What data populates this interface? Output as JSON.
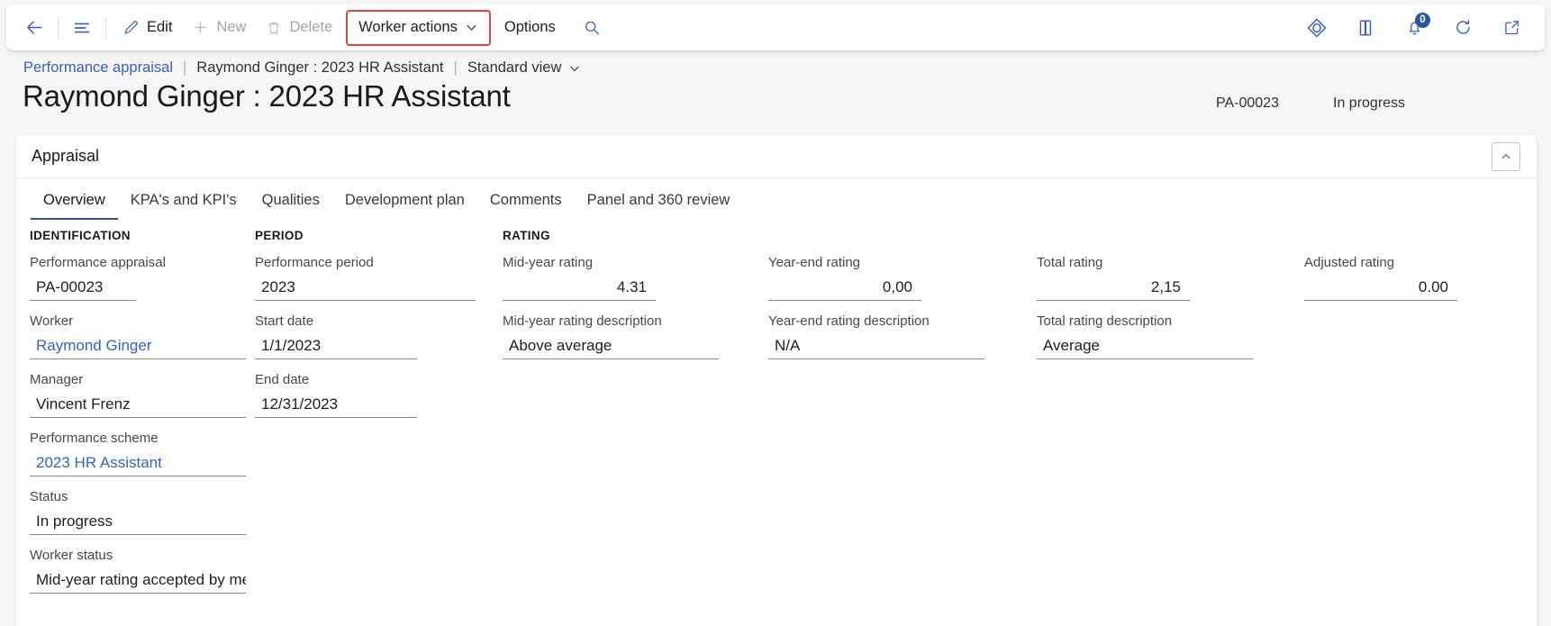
{
  "commandbar": {
    "back_label": "Back",
    "nav_label": "Show navigation pane",
    "edit_label": "Edit",
    "new_label": "New",
    "delete_label": "Delete",
    "worker_actions_label": "Worker actions",
    "options_label": "Options",
    "search_label": "Search",
    "right_icons": [
      {
        "name": "flow-icon",
        "label": "Power Automate"
      },
      {
        "name": "office-apps-icon",
        "label": "Office"
      },
      {
        "name": "notifications-icon",
        "label": "Notifications",
        "badge": "0"
      },
      {
        "name": "refresh-icon",
        "label": "Refresh"
      },
      {
        "name": "open-in-new-window-icon",
        "label": "Open in new window"
      }
    ],
    "highlight_color": "#e8443a"
  },
  "breadcrumb": {
    "parent": "Performance appraisal",
    "current": "Raymond Ginger : 2023 HR Assistant",
    "view": "Standard view",
    "separator": "|"
  },
  "header": {
    "title": "Raymond Ginger : 2023 HR Assistant",
    "record_id": "PA-00023",
    "status": "In progress"
  },
  "card": {
    "title": "Appraisal",
    "collapse_label": "Collapse"
  },
  "tabs": [
    {
      "label": "Overview",
      "active": true
    },
    {
      "label": "KPA's and KPI's",
      "active": false
    },
    {
      "label": "Qualities",
      "active": false
    },
    {
      "label": "Development plan",
      "active": false
    },
    {
      "label": "Comments",
      "active": false
    },
    {
      "label": "Panel and 360 review",
      "active": false
    }
  ],
  "sections": {
    "identification": {
      "heading": "IDENTIFICATION",
      "fields": [
        {
          "label": "Performance appraisal",
          "value": "PA-00023",
          "link": false
        },
        {
          "label": "Worker",
          "value": "Raymond Ginger",
          "link": true
        },
        {
          "label": "Manager",
          "value": "Vincent Frenz",
          "link": false
        },
        {
          "label": "Performance scheme",
          "value": "2023 HR Assistant",
          "link": true
        },
        {
          "label": "Status",
          "value": "In progress",
          "link": false
        },
        {
          "label": "Worker status",
          "value": "Mid-year rating accepted by me",
          "link": false
        }
      ]
    },
    "period": {
      "heading": "PERIOD",
      "fields": [
        {
          "label": "Performance period",
          "value": "2023"
        },
        {
          "label": "Start date",
          "value": "1/1/2023"
        },
        {
          "label": "End date",
          "value": "12/31/2023"
        }
      ]
    },
    "rating": {
      "heading": "RATING",
      "fields": [
        {
          "label": "Mid-year rating",
          "value": "4.31"
        },
        {
          "label": "Mid-year rating description",
          "value": "Above average"
        },
        {
          "label": "Year-end rating",
          "value": "0,00"
        },
        {
          "label": "Year-end rating description",
          "value": "N/A"
        },
        {
          "label": "Total rating",
          "value": "2,15"
        },
        {
          "label": "Total rating description",
          "value": "Average"
        },
        {
          "label": "Adjusted rating",
          "value": "0.00"
        }
      ]
    }
  }
}
